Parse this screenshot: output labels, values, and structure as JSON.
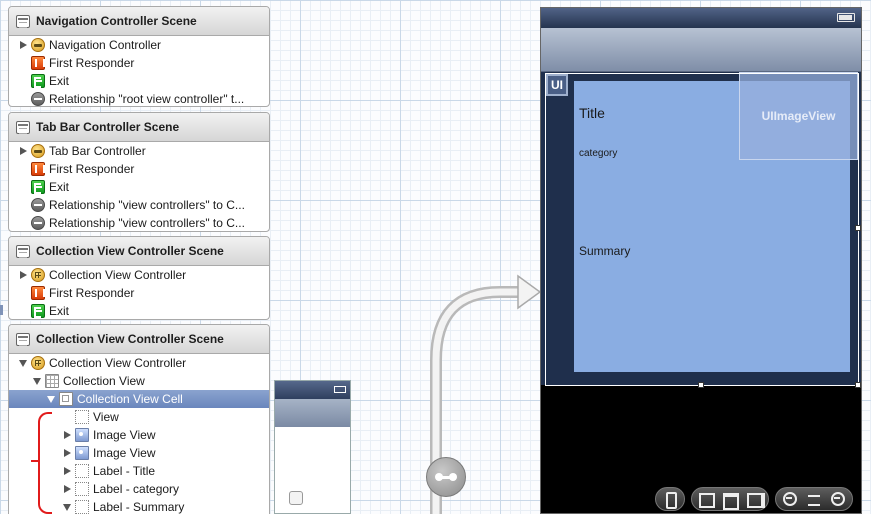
{
  "outline": {
    "scenes": [
      {
        "title": "Navigation Controller Scene",
        "items": [
          {
            "label": "Navigation Controller",
            "icon": "navigation-controller-icon"
          },
          {
            "label": "First Responder",
            "icon": "first-responder-icon"
          },
          {
            "label": "Exit",
            "icon": "exit-icon"
          },
          {
            "label": "Relationship \"root view controller\" t...",
            "icon": "relationship-icon"
          }
        ]
      },
      {
        "title": "Tab Bar Controller Scene",
        "items": [
          {
            "label": "Tab Bar Controller",
            "icon": "tab-bar-controller-icon"
          },
          {
            "label": "First Responder",
            "icon": "first-responder-icon"
          },
          {
            "label": "Exit",
            "icon": "exit-icon"
          },
          {
            "label": "Relationship \"view controllers\" to C...",
            "icon": "relationship-icon"
          },
          {
            "label": "Relationship \"view controllers\" to C...",
            "icon": "relationship-icon"
          }
        ]
      },
      {
        "title": "Collection View Controller Scene",
        "items": [
          {
            "label": "Collection View Controller",
            "icon": "collection-view-controller-icon"
          },
          {
            "label": "First Responder",
            "icon": "first-responder-icon"
          },
          {
            "label": "Exit",
            "icon": "exit-icon"
          }
        ]
      },
      {
        "title": "Collection View Controller Scene",
        "items": [
          {
            "label": "Collection View Controller",
            "icon": "collection-view-controller-icon"
          },
          {
            "label": "Collection View",
            "icon": "collection-view-icon"
          },
          {
            "label": "Collection View Cell",
            "icon": "collection-view-cell-icon"
          },
          {
            "label": "View",
            "icon": "view-icon"
          },
          {
            "label": "Image View",
            "icon": "image-view-icon"
          },
          {
            "label": "Image View",
            "icon": "image-view-icon"
          },
          {
            "label": "Label - Title",
            "icon": "label-icon"
          },
          {
            "label": "Label - category",
            "icon": "label-icon"
          },
          {
            "label": "Label - Summary",
            "icon": "label-icon"
          }
        ]
      }
    ]
  },
  "canvas": {
    "cell": {
      "ui_badge": "UI",
      "title_label": "Title",
      "category_label": "category",
      "summary_label": "Summary",
      "imageview_placeholder": "UIImageView"
    },
    "colors": {
      "cell_content": "#8aade2",
      "collection_background": "#1f2f4c",
      "selection": "#6a86bd",
      "annotation_bracket": "#e11b1b"
    }
  }
}
